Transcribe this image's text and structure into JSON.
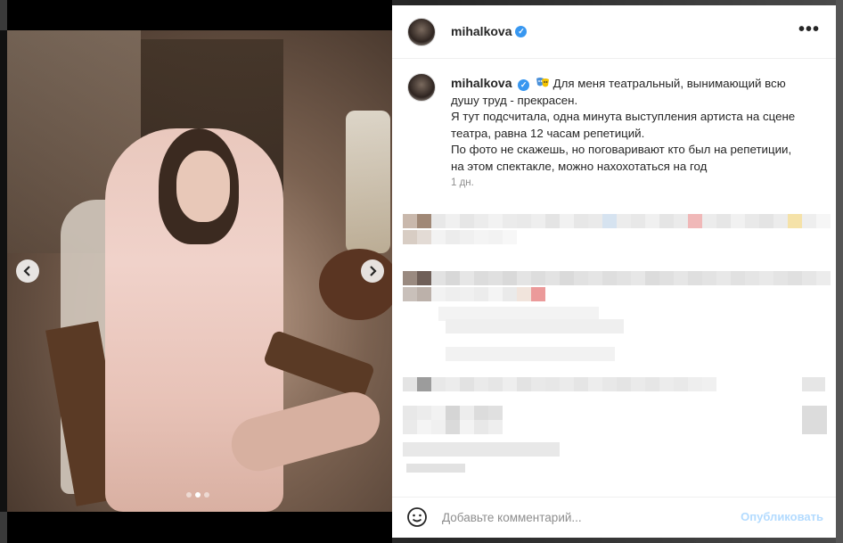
{
  "post": {
    "username": "mihalkova",
    "verified": true,
    "caption_lines": [
      "Для меня театральный, вынимающий всю",
      "душу труд - прекрасен.",
      "Я тут подсчитала, одна минута выступления артиста на сцене",
      "театра, равна 12 часам репетиций.",
      "По фото не скажешь, но поговаривают кто был на репетиции,",
      "на этом спектакле, можно нахохотаться на год"
    ],
    "time": "1 дн.",
    "carousel": {
      "total": 3,
      "active_index": 1
    }
  },
  "icons": {
    "more": "more-options-icon",
    "verified": "verified-badge-icon",
    "emoji": "emoji-smile-icon",
    "prev": "chevron-left-icon",
    "next": "chevron-right-icon",
    "mask": "theater-masks-emoji-icon"
  },
  "comment": {
    "placeholder": "Добавьте комментарий...",
    "publish_label": "Опубликовать"
  },
  "colors": {
    "verified": "#3897f0",
    "publish_disabled": "#b3dbff",
    "text": "#262626",
    "muted": "#8e8e8e"
  }
}
